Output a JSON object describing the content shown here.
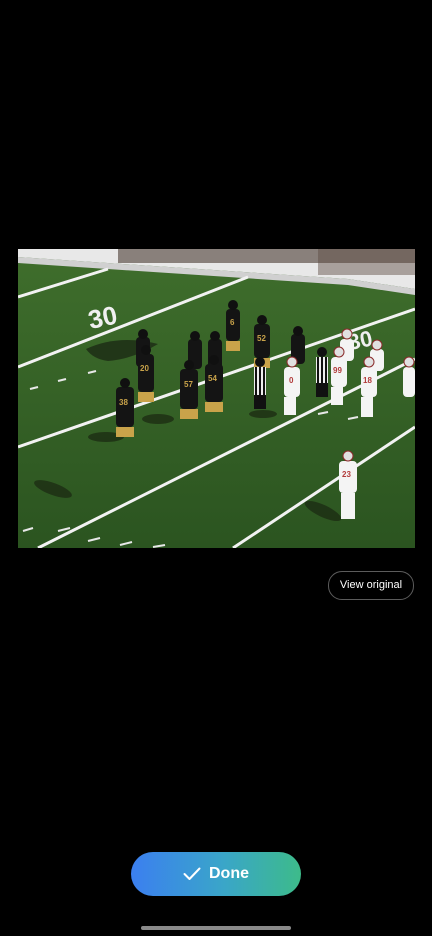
{
  "photo": {
    "description_icon": "photo-image",
    "yard_numbers": [
      "30",
      "30"
    ],
    "jersey_numbers_dark": [
      "6",
      "52",
      "20",
      "54",
      "57",
      "38"
    ],
    "jersey_numbers_white": [
      "0",
      "99",
      "18",
      "23"
    ]
  },
  "actions": {
    "view_original_label": "View original",
    "done_label": "Done",
    "done_icon": "checkmark-icon"
  },
  "colors": {
    "background": "#000000",
    "done_gradient_start": "#3b7ff0",
    "done_gradient_end": "#3dbb8a"
  }
}
